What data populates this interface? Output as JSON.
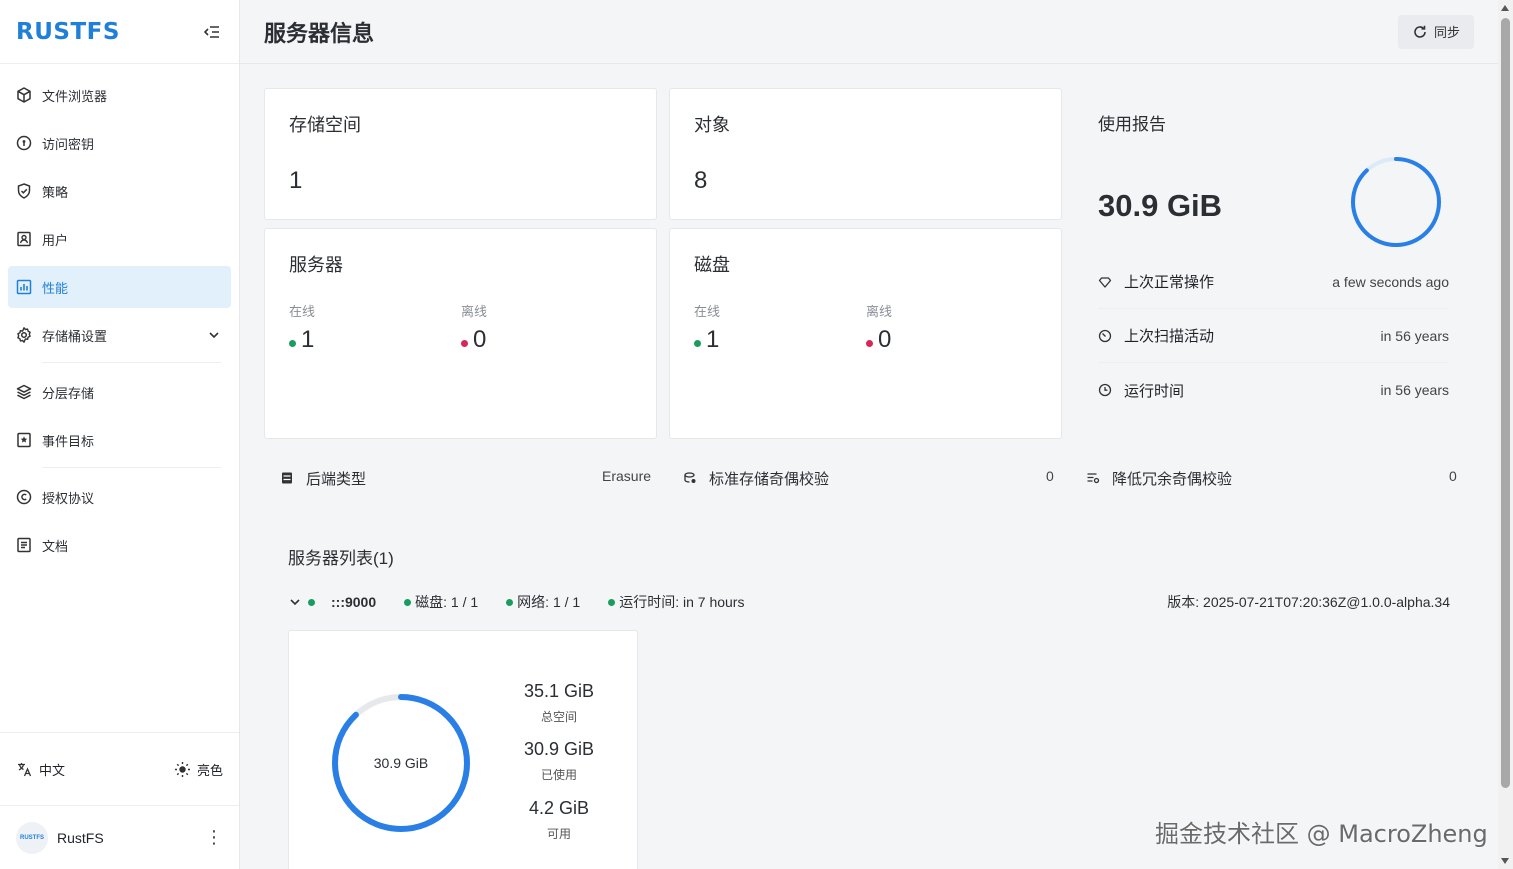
{
  "app": {
    "logo": "RUSTFS",
    "page_title": "服务器信息",
    "sync_label": "同步"
  },
  "sidebar": {
    "items": [
      {
        "label": "文件浏览器",
        "icon": "box-icon"
      },
      {
        "label": "访问密钥",
        "icon": "key-circle-icon"
      },
      {
        "label": "策略",
        "icon": "shield-check-icon"
      },
      {
        "label": "用户",
        "icon": "user-icon"
      },
      {
        "label": "性能",
        "icon": "chart-icon",
        "active": true
      },
      {
        "label": "存储桶设置",
        "icon": "gear-icon"
      },
      {
        "label": "分层存储",
        "icon": "layers-icon"
      },
      {
        "label": "事件目标",
        "icon": "bookmark-star-icon"
      },
      {
        "label": "授权协议",
        "icon": "copyright-icon"
      },
      {
        "label": "文档",
        "icon": "document-icon"
      }
    ],
    "language": "中文",
    "theme": "亮色",
    "user": {
      "avatar_text": "RUSTFS",
      "name": "RustFS"
    }
  },
  "stats": {
    "buckets": {
      "title": "存储空间",
      "value": "1"
    },
    "objects": {
      "title": "对象",
      "value": "8"
    },
    "servers": {
      "title": "服务器",
      "online_label": "在线",
      "online": "1",
      "offline_label": "离线",
      "offline": "0"
    },
    "disks": {
      "title": "磁盘",
      "online_label": "在线",
      "online": "1",
      "offline_label": "离线",
      "offline": "0"
    }
  },
  "usage": {
    "title": "使用报告",
    "size": "30.9 GiB",
    "used_fraction": 0.88,
    "rows": [
      {
        "label": "上次正常操作",
        "value": "a few seconds ago"
      },
      {
        "label": "上次扫描活动",
        "value": "in 56 years"
      },
      {
        "label": "运行时间",
        "value": "in 56 years"
      }
    ]
  },
  "info": {
    "backend": {
      "label": "后端类型",
      "value": "Erasure"
    },
    "standard_parity": {
      "label": "标准存储奇偶校验",
      "value": "0"
    },
    "reduced_parity": {
      "label": "降低冗余奇偶校验",
      "value": "0"
    }
  },
  "server_list": {
    "title": "服务器列表(1)",
    "host": ":::9000",
    "disks": "磁盘: 1 / 1",
    "network": "网络: 1 / 1",
    "uptime": "运行时间: in 7 hours",
    "version": "版本: 2025-07-21T07:20:36Z@1.0.0-alpha.34",
    "disk_card": {
      "ring_label": "30.9 GiB",
      "used_fraction": 0.88,
      "total_value": "35.1 GiB",
      "total_label": "总空间",
      "used_value": "30.9 GiB",
      "used_label": "已使用",
      "free_value": "4.2 GiB",
      "free_label": "可用"
    }
  },
  "colors": {
    "accent": "#1f7fd9",
    "ring_blue": "#2a7fe6",
    "online": "#1a9c5f",
    "offline": "#d6275a"
  },
  "watermark": "掘金技术社区 @ MacroZheng"
}
